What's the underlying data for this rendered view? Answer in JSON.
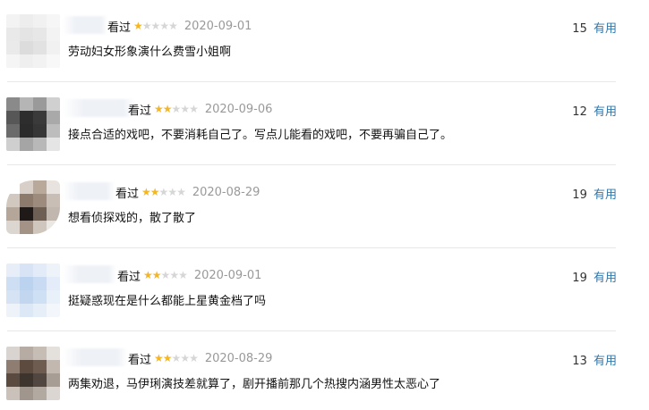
{
  "reviews": [
    {
      "viewed": "看过",
      "rating": 1,
      "max_rating": 5,
      "date": "2020-09-01",
      "comment": "劳动妇女形象演什么费雪小姐啊",
      "useful_count": "15",
      "useful_label": "有用",
      "avatar_colors": [
        "#f3f3f3",
        "#ededed",
        "#f1f1f1",
        "#f6f6f6",
        "#e9e9e9",
        "#e4e4e4",
        "#e7e7e7",
        "#f3f3f3",
        "#eaeaea",
        "#dcdcdc",
        "#e2e2e2",
        "#f1f1f1",
        "#f5f5f5",
        "#efefef",
        "#f2f2f2",
        "#f8f8f8"
      ]
    },
    {
      "viewed": "看过",
      "rating": 2,
      "max_rating": 5,
      "date": "2020-09-06",
      "comment": "接点合适的戏吧，不要消耗自己了。写点儿能看的戏吧，不要再骗自己了。",
      "useful_count": "12",
      "useful_label": "有用",
      "avatar_colors": [
        "#8a8a8a",
        "#b5b5b5",
        "#9a9a9a",
        "#d0d0d0",
        "#575757",
        "#2d2d2d",
        "#3a3a3a",
        "#a9a9a9",
        "#6b6b6b",
        "#2b2b2b",
        "#363636",
        "#bdbdbd",
        "#cfcfcf",
        "#a5a5a5",
        "#b8b8b8",
        "#e5e5e5"
      ]
    },
    {
      "viewed": "看过",
      "rating": 2,
      "max_rating": 5,
      "date": "2020-08-29",
      "comment": "想看侦探戏的，散了散了",
      "useful_count": "19",
      "useful_label": "有用",
      "avatar_colors": [
        "#ffffff",
        "#d8d0c8",
        "#b9a99b",
        "#e8e3de",
        "#d1c8c0",
        "#8c7a6c",
        "#9d8b7d",
        "#c8beb5",
        "#b4a699",
        "#1f1a18",
        "#6e5f55",
        "#c2b7ae",
        "#dcd6d0",
        "#a39387",
        "#cfc6bd",
        "#ebe7e3"
      ]
    },
    {
      "viewed": "看过",
      "rating": 2,
      "max_rating": 5,
      "date": "2020-09-01",
      "comment": "挺疑惑现在是什么都能上星黄金档了吗",
      "useful_count": "19",
      "useful_label": "有用",
      "avatar_colors": [
        "#e7eef8",
        "#d8e4f5",
        "#e2ebf7",
        "#eef3fa",
        "#cfdff3",
        "#bcd3ef",
        "#c8dbf2",
        "#e3ecf8",
        "#d6e3f4",
        "#c2d6f0",
        "#cde0f4",
        "#e8f0f9",
        "#eef3fa",
        "#dde8f6",
        "#e6eef8",
        "#f3f7fb"
      ]
    },
    {
      "viewed": "看过",
      "rating": 2,
      "max_rating": 5,
      "date": "2020-08-29",
      "comment": "两集劝退，马伊琍演技差就算了，剧开播前那几个热搜内涵男性太恶心了",
      "useful_count": "13",
      "useful_label": "有用",
      "avatar_colors": [
        "#d9d4cf",
        "#b7aca3",
        "#c6bdb5",
        "#e4e0dc",
        "#8e7d70",
        "#5e4b3f",
        "#6f5c50",
        "#c2b8af",
        "#5a4a40",
        "#3e342e",
        "#514640",
        "#a89d94",
        "#c9c1ba",
        "#a0968e",
        "#b2a9a1",
        "#dbd6d1"
      ]
    }
  ]
}
